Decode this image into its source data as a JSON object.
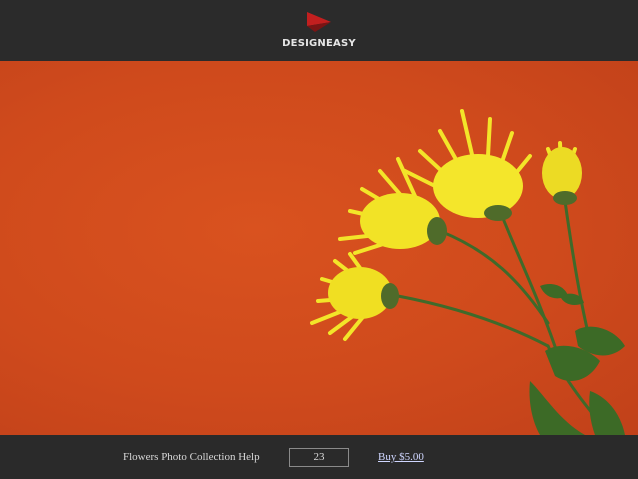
{
  "header": {
    "brand": "DESIGNEASY",
    "logo_icon": "red-flag-triangle-icon",
    "logo_color": "#c21f1f"
  },
  "photo": {
    "background_color": "#d24c1d",
    "flower_color": "#f3e529",
    "stem_color": "#3f6a2a"
  },
  "footer": {
    "help_text": "Flowers Photo Collection Help",
    "count": "23",
    "buy_label": "Buy $5.00"
  }
}
